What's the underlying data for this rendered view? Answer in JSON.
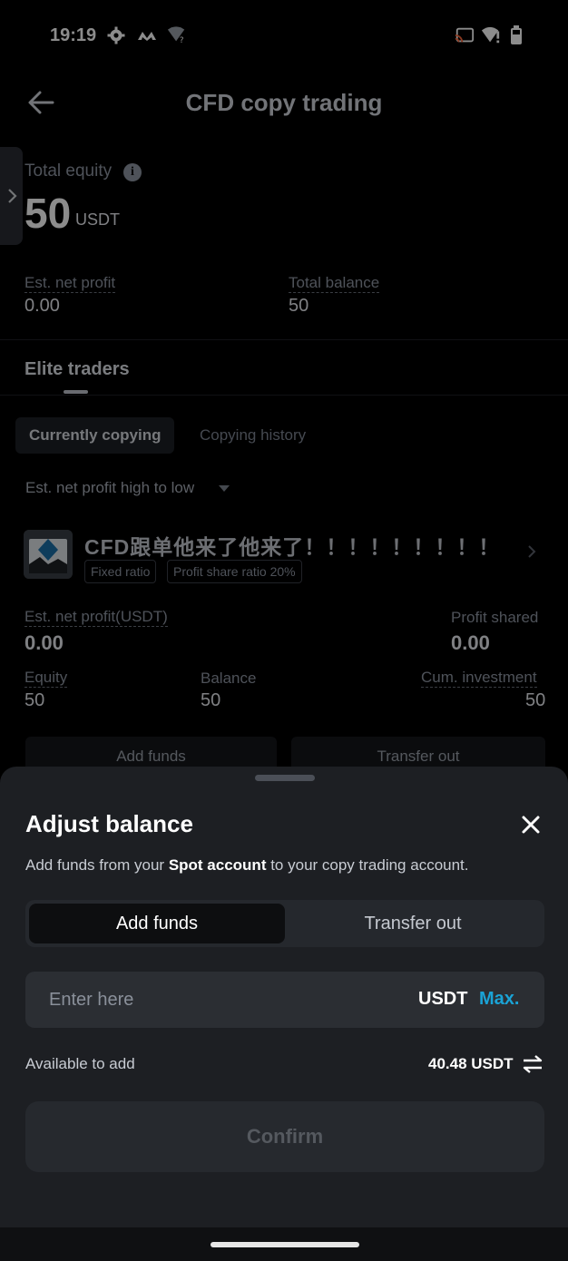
{
  "status_bar": {
    "time": "19:19",
    "icons": [
      "gear-icon",
      "app-icon",
      "wifi-question-icon",
      "cast-icon",
      "wifi-alert-icon",
      "battery-icon"
    ]
  },
  "header": {
    "title": "CFD copy trading",
    "back_icon": "arrow-left-icon"
  },
  "summary": {
    "total_equity_label": "Total equity",
    "total_equity_value": "50",
    "total_equity_unit": "USDT",
    "est_net_profit_label": "Est. net profit",
    "est_net_profit_value": "0.00",
    "total_balance_label": "Total balance",
    "total_balance_value": "50"
  },
  "section": {
    "title": "Elite traders",
    "tabs": [
      "Currently copying",
      "Copying history"
    ],
    "sort_label": "Est. net profit high to low"
  },
  "trader": {
    "name": "CFD跟单他来了他来了！！！！！！！！！",
    "tags": [
      "Fixed ratio",
      "Profit share ratio 20%"
    ],
    "est_net_profit_label": "Est. net profit(USDT)",
    "est_net_profit_value": "0.00",
    "profit_shared_label": "Profit shared",
    "profit_shared_value": "0.00",
    "equity_label": "Equity",
    "equity_value": "50",
    "balance_label": "Balance",
    "balance_value": "50",
    "cum_investment_label": "Cum. investment",
    "cum_investment_value": "50",
    "add_funds_label": "Add funds",
    "transfer_out_label": "Transfer out"
  },
  "sheet": {
    "title": "Adjust balance",
    "desc_prefix": "Add funds from your ",
    "desc_bold": "Spot account",
    "desc_suffix": " to your copy trading account.",
    "segments": [
      "Add funds",
      "Transfer out"
    ],
    "amount_placeholder": "Enter here",
    "amount_unit": "USDT",
    "max_label": "Max.",
    "available_label": "Available to add",
    "available_value": "40.48 USDT",
    "confirm_label": "Confirm"
  },
  "colors": {
    "accent": "#1aa3d6",
    "sheet_bg": "#1d1f23"
  }
}
